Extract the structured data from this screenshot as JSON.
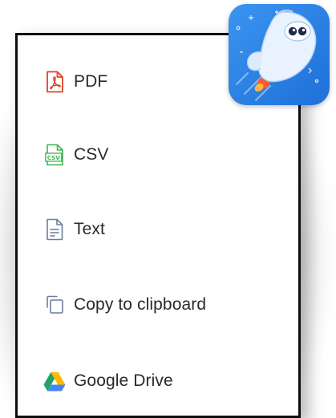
{
  "menu": {
    "items": [
      {
        "label": "PDF",
        "icon": "pdf-file-icon",
        "color": "#e04428"
      },
      {
        "label": "CSV",
        "icon": "csv-file-icon",
        "color": "#3fb54f"
      },
      {
        "label": "Text",
        "icon": "text-file-icon",
        "color": "#6b7f9e"
      },
      {
        "label": "Copy to clipboard",
        "icon": "copy-icon",
        "color": "#6b7f9e"
      },
      {
        "label": "Google Drive",
        "icon": "google-drive-icon",
        "color": "#1fa463"
      }
    ]
  },
  "app_icon": {
    "name": "sora-app-icon",
    "background": "#2f86ea"
  }
}
